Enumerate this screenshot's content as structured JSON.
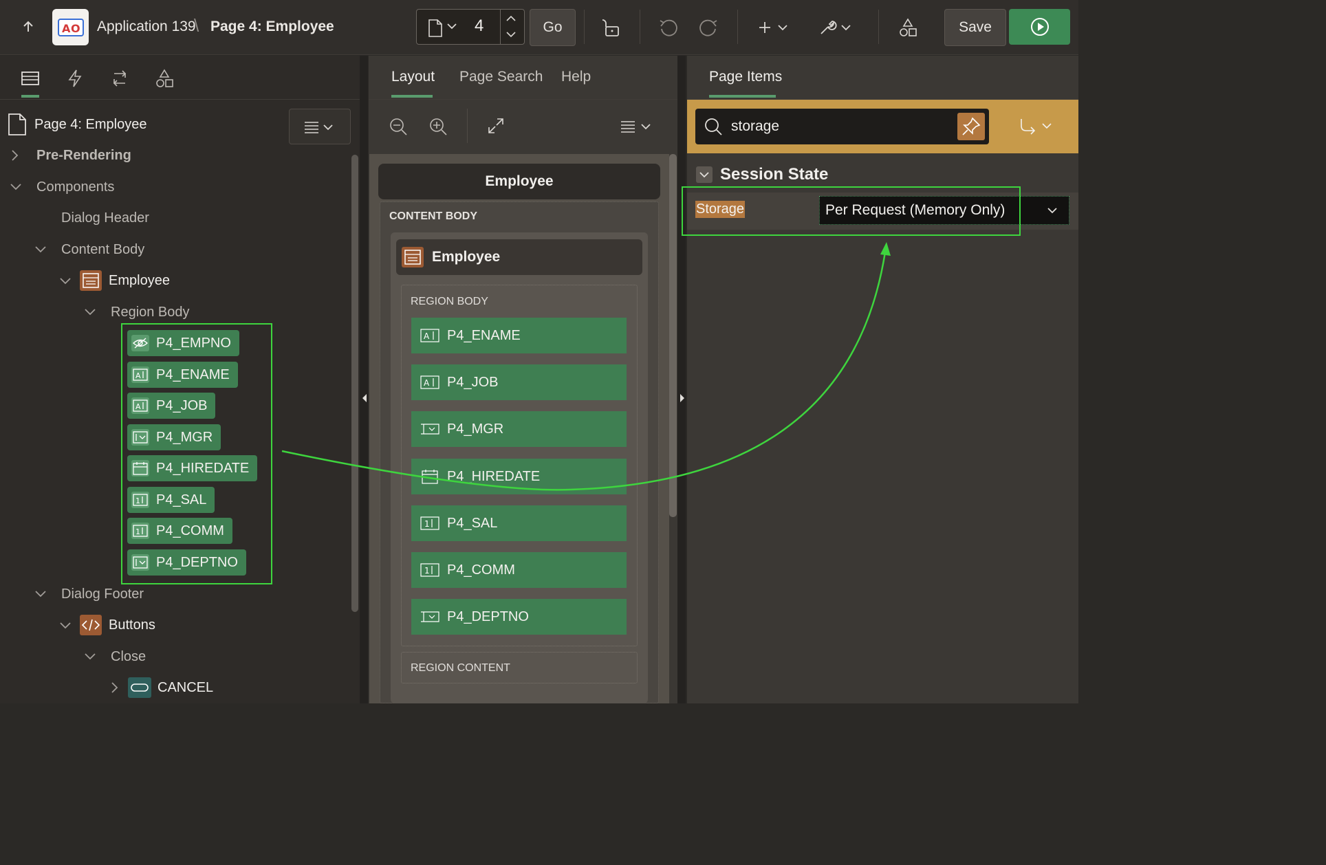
{
  "header": {
    "app_title": "Application 139",
    "separator": "\\",
    "page_title": "Page 4: Employee",
    "page_number": "4",
    "go_label": "Go",
    "save_label": "Save",
    "app_logo_text": "AO"
  },
  "left_panel": {
    "root": "Page 4: Employee",
    "tree": {
      "pre_rendering": "Pre-Rendering",
      "components": "Components",
      "dialog_header": "Dialog Header",
      "content_body": "Content Body",
      "employee": "Employee",
      "region_body": "Region Body",
      "items": [
        "P4_EMPNO",
        "P4_ENAME",
        "P4_JOB",
        "P4_MGR",
        "P4_HIREDATE",
        "P4_SAL",
        "P4_COMM",
        "P4_DEPTNO"
      ],
      "dialog_footer": "Dialog Footer",
      "buttons": "Buttons",
      "close": "Close",
      "cancel": "CANCEL"
    }
  },
  "middle_panel": {
    "tabs": [
      "Layout",
      "Page Search",
      "Help"
    ],
    "active_tab": "Layout",
    "page_header": "Employee",
    "content_body_label": "CONTENT BODY",
    "region_title": "Employee",
    "region_body_label": "REGION BODY",
    "items": [
      "P4_ENAME",
      "P4_JOB",
      "P4_MGR",
      "P4_HIREDATE",
      "P4_SAL",
      "P4_COMM",
      "P4_DEPTNO"
    ],
    "region_content_label": "REGION CONTENT"
  },
  "right_panel": {
    "tab": "Page Items",
    "search_value": "storage",
    "section_title": "Session State",
    "property_label": "Storage",
    "property_value": "Per Request (Memory Only)"
  },
  "colors": {
    "item_green": "#3f7f52",
    "accent_gold": "#c79a4a",
    "annotation_green": "#3ed53e",
    "run_green": "#3d8a55"
  }
}
